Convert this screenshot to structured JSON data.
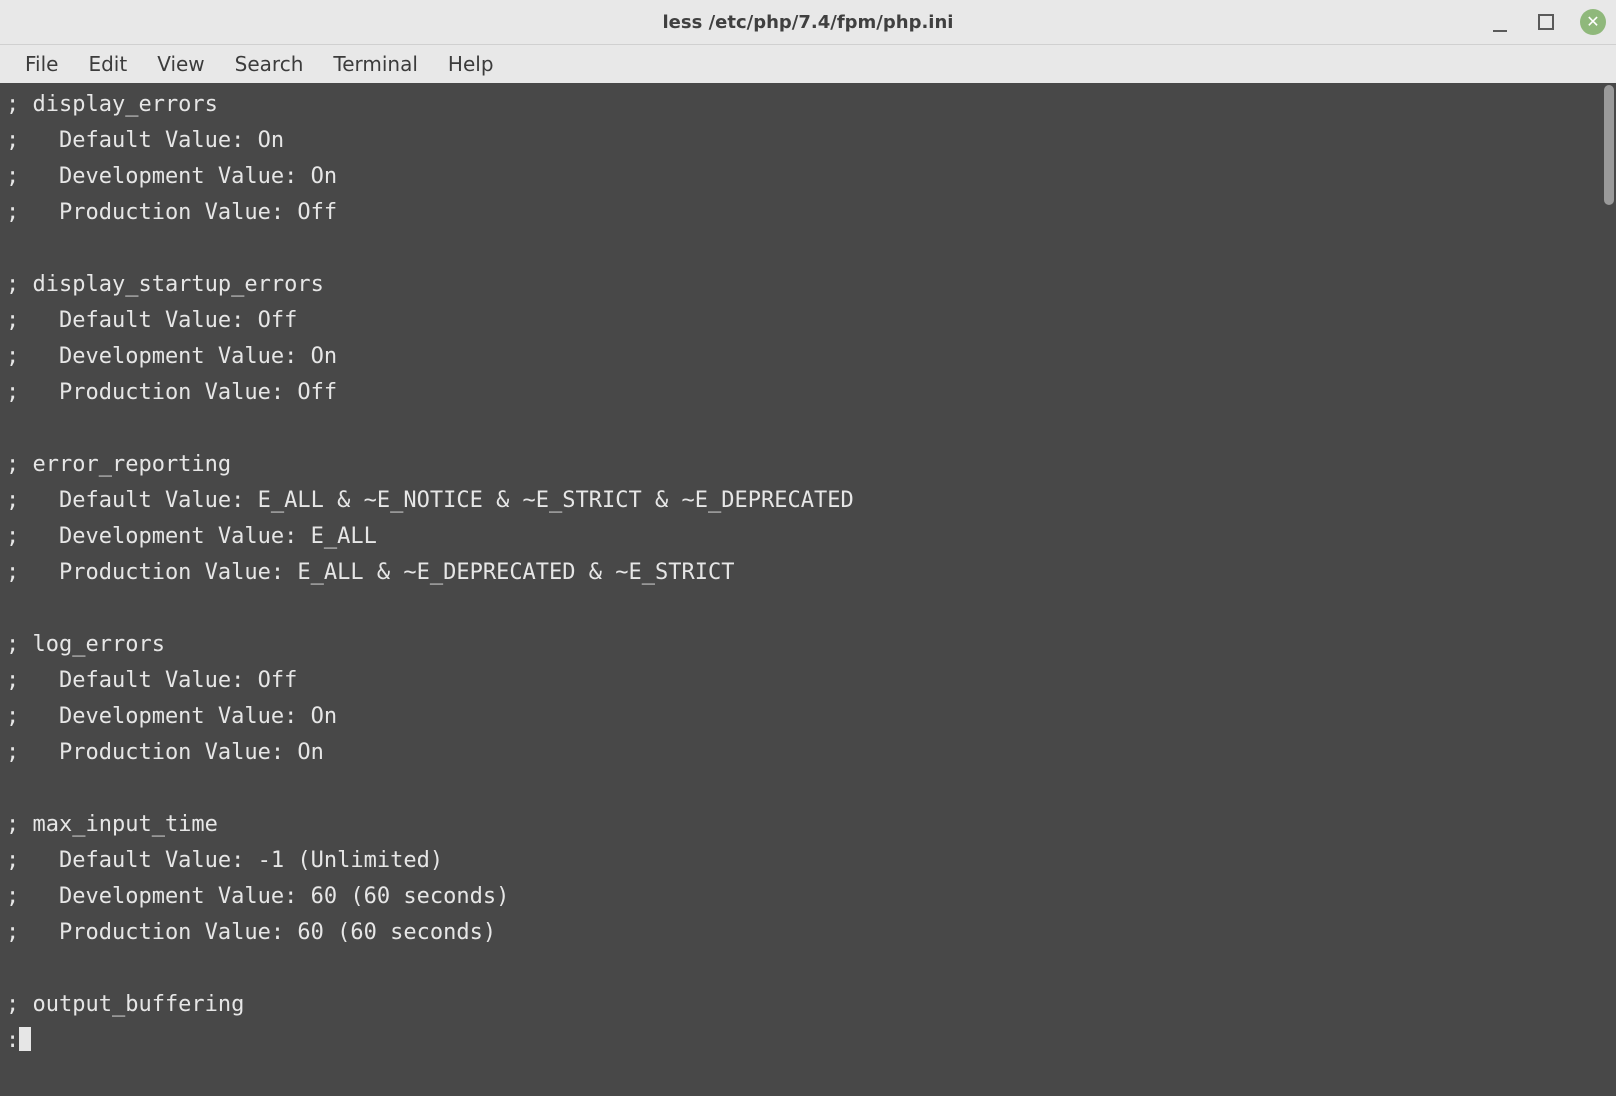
{
  "window": {
    "title": "less /etc/php/7.4/fpm/php.ini"
  },
  "menubar": {
    "items": [
      "File",
      "Edit",
      "View",
      "Search",
      "Terminal",
      "Help"
    ]
  },
  "terminal": {
    "lines": [
      "; display_errors",
      ";   Default Value: On",
      ";   Development Value: On",
      ";   Production Value: Off",
      "",
      "; display_startup_errors",
      ";   Default Value: Off",
      ";   Development Value: On",
      ";   Production Value: Off",
      "",
      "; error_reporting",
      ";   Default Value: E_ALL & ~E_NOTICE & ~E_STRICT & ~E_DEPRECATED",
      ";   Development Value: E_ALL",
      ";   Production Value: E_ALL & ~E_DEPRECATED & ~E_STRICT",
      "",
      "; log_errors",
      ";   Default Value: Off",
      ";   Development Value: On",
      ";   Production Value: On",
      "",
      "; max_input_time",
      ";   Default Value: -1 (Unlimited)",
      ";   Development Value: 60 (60 seconds)",
      ";   Production Value: 60 (60 seconds)",
      "",
      "; output_buffering"
    ],
    "prompt": ":"
  },
  "colors": {
    "terminal_bg": "#484848",
    "terminal_fg": "#e6e6e6",
    "chrome_bg": "#e8e8e8",
    "close_button": "#8fb87b"
  }
}
